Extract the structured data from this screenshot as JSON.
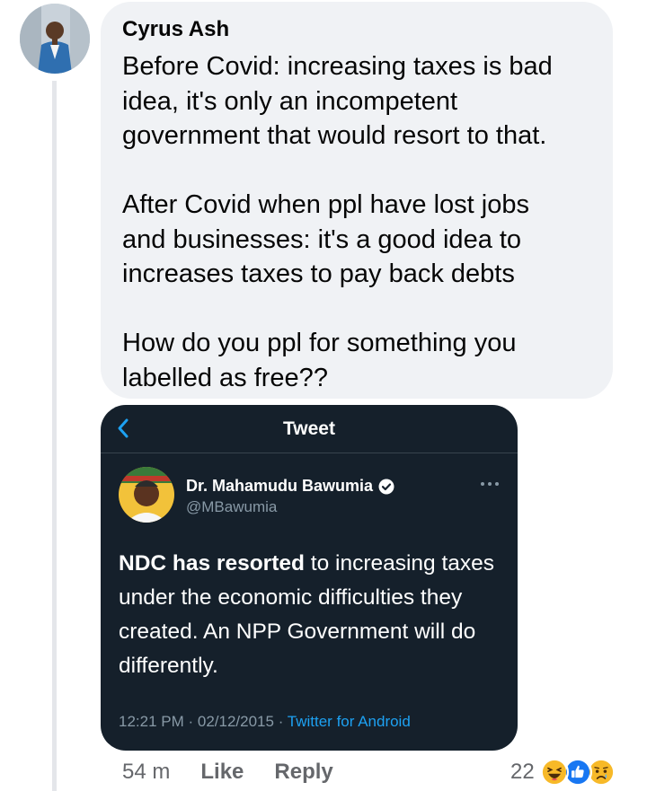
{
  "comment": {
    "author": "Cyrus Ash",
    "lines": [
      "Before Covid: increasing taxes is bad",
      "idea, it's only an incompetent",
      "government that would resort to that.",
      "",
      "After Covid when ppl have lost jobs",
      "and businesses: it's a good idea to",
      "increases taxes to pay back debts",
      "",
      "How do you ppl for something you",
      "labelled as free??"
    ]
  },
  "tweet": {
    "header_title": "Tweet",
    "name": "Dr. Mahamudu Bawumia",
    "handle": "@MBawumia",
    "text_bold": "NDC has resorted",
    "text_rest": " to increasing taxes under the economic difficulties they created. An NPP Government will do differently.",
    "time": "12:21 PM",
    "date": "02/12/2015",
    "separator": " · ",
    "source": "Twitter for Android"
  },
  "actions": {
    "time": "54 m",
    "like_label": "Like",
    "reply_label": "Reply"
  },
  "reactions": {
    "count": "22",
    "icons": [
      "haha-icon",
      "like-icon",
      "sad-icon"
    ]
  },
  "colors": {
    "bubble_bg": "#f0f2f5",
    "tweet_bg": "#15202b",
    "link_blue": "#1da1f2",
    "meta_gray": "#65676b"
  }
}
